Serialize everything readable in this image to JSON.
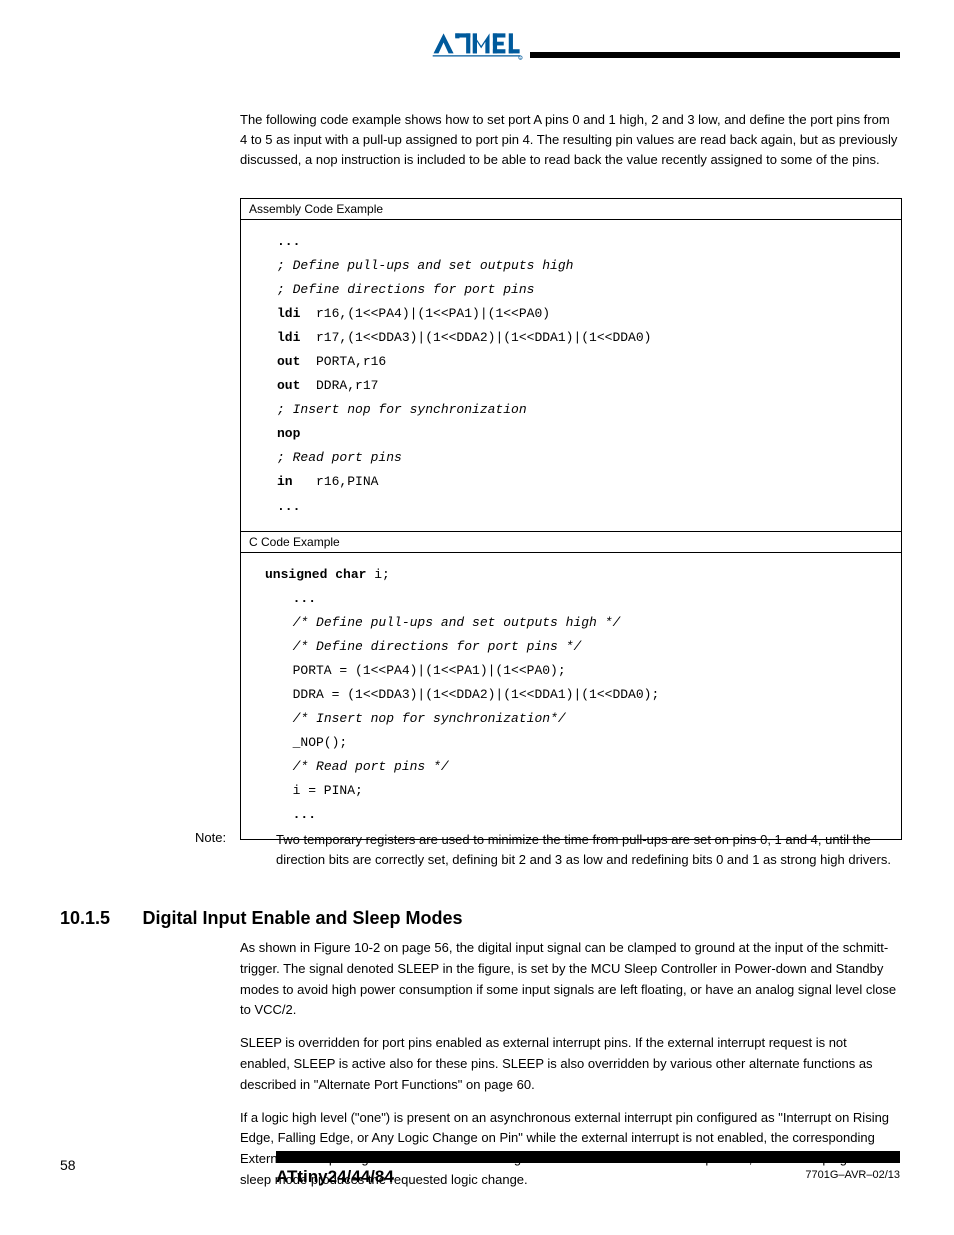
{
  "header": {
    "logo_alt": "Atmel"
  },
  "lead": {
    "p1": "The following code example shows how to set port A pins 0 and 1 high, 2 and 3 low, and define the port pins from 4 to 5 as input with a pull-up assigned to port pin 4. The resulting pin values are read back again, but as previously discussed, a nop instruction is included to be able to read back the value recently assigned to some of the pins."
  },
  "code": {
    "asm_label": "Assembly Code Example",
    "asm_lines": [
      {
        "b": true,
        "t": "..."
      },
      {
        "i": true,
        "t": "; Define pull-ups and set outputs high"
      },
      {
        "i": true,
        "t": "; Define directions for port pins"
      },
      {
        "kw": "ldi",
        "args": "r16,(1<<PA4)|(1<<PA1)|(1<<PA0)"
      },
      {
        "kw": "ldi",
        "args": "r17,(1<<DDA3)|(1<<DDA2)|(1<<DDA1)|(1<<DDA0)"
      },
      {
        "kw": "out",
        "args": "PORTA,r16"
      },
      {
        "kw": "out",
        "args": "DDRA,r17"
      },
      {
        "i": true,
        "t": "; Insert nop for synchronization"
      },
      {
        "b": true,
        "t": "nop"
      },
      {
        "i": true,
        "t": "; Read port pins"
      },
      {
        "kw": "in",
        "args": "r16,PINA"
      },
      {
        "b": true,
        "t": "..."
      }
    ],
    "c_label": "C Code Example",
    "c_decl_kw": "unsigned char",
    "c_decl_rest": " i;",
    "c_lines": [
      {
        "b": true,
        "t": "..."
      },
      {
        "i": true,
        "t": "/* Define pull-ups and set outputs high */"
      },
      {
        "i": true,
        "t": "/* Define directions for port pins */"
      },
      {
        "t": "PORTA = (1<<PA4)|(1<<PA1)|(1<<PA0);"
      },
      {
        "t": "DDRA = (1<<DDA3)|(1<<DDA2)|(1<<DDA1)|(1<<DDA0);"
      },
      {
        "i": true,
        "t": "/* Insert nop for synchronization*/"
      },
      {
        "t": "_NOP();"
      },
      {
        "i": true,
        "t": "/* Read port pins */"
      },
      {
        "t": "i = PINA;"
      },
      {
        "b": true,
        "t": "..."
      }
    ]
  },
  "note": {
    "label": "Note:",
    "body": "Two temporary registers are used to minimize the time from pull-ups are set on pins 0, 1 and 4, until the direction bits are correctly set, defining bit 2 and 3 as low and redefining bits 0 and 1 as strong high drivers."
  },
  "section": {
    "num": "10.1.5",
    "title": "Digital Input Enable and Sleep Modes",
    "p1": "As shown in Figure 10-2 on page 56, the digital input signal can be clamped to ground at the input of the schmitt-trigger. The signal denoted SLEEP in the figure, is set by the MCU Sleep Controller in Power-down and Standby modes to avoid high power consumption if some input signals are left floating, or have an analog signal level close to VCC/2.",
    "p2": "SLEEP is overridden for port pins enabled as external interrupt pins. If the external interrupt request is not enabled, SLEEP is active also for these pins. SLEEP is also overridden by various other alternate functions as described in \"Alternate Port Functions\" on page 60.",
    "p3": "If a logic high level (\"one\") is present on an asynchronous external interrupt pin configured as \"Interrupt on Rising Edge, Falling Edge, or Any Logic Change on Pin\" while the external interrupt is not enabled, the corresponding External Interrupt Flag will be set when resuming from the above mentioned Sleep mode, as the clamping in these sleep mode produces the requested logic change."
  },
  "footer": {
    "page": "58",
    "title": "ATtiny24/44/84",
    "code": "7701G–AVR–02/13"
  }
}
